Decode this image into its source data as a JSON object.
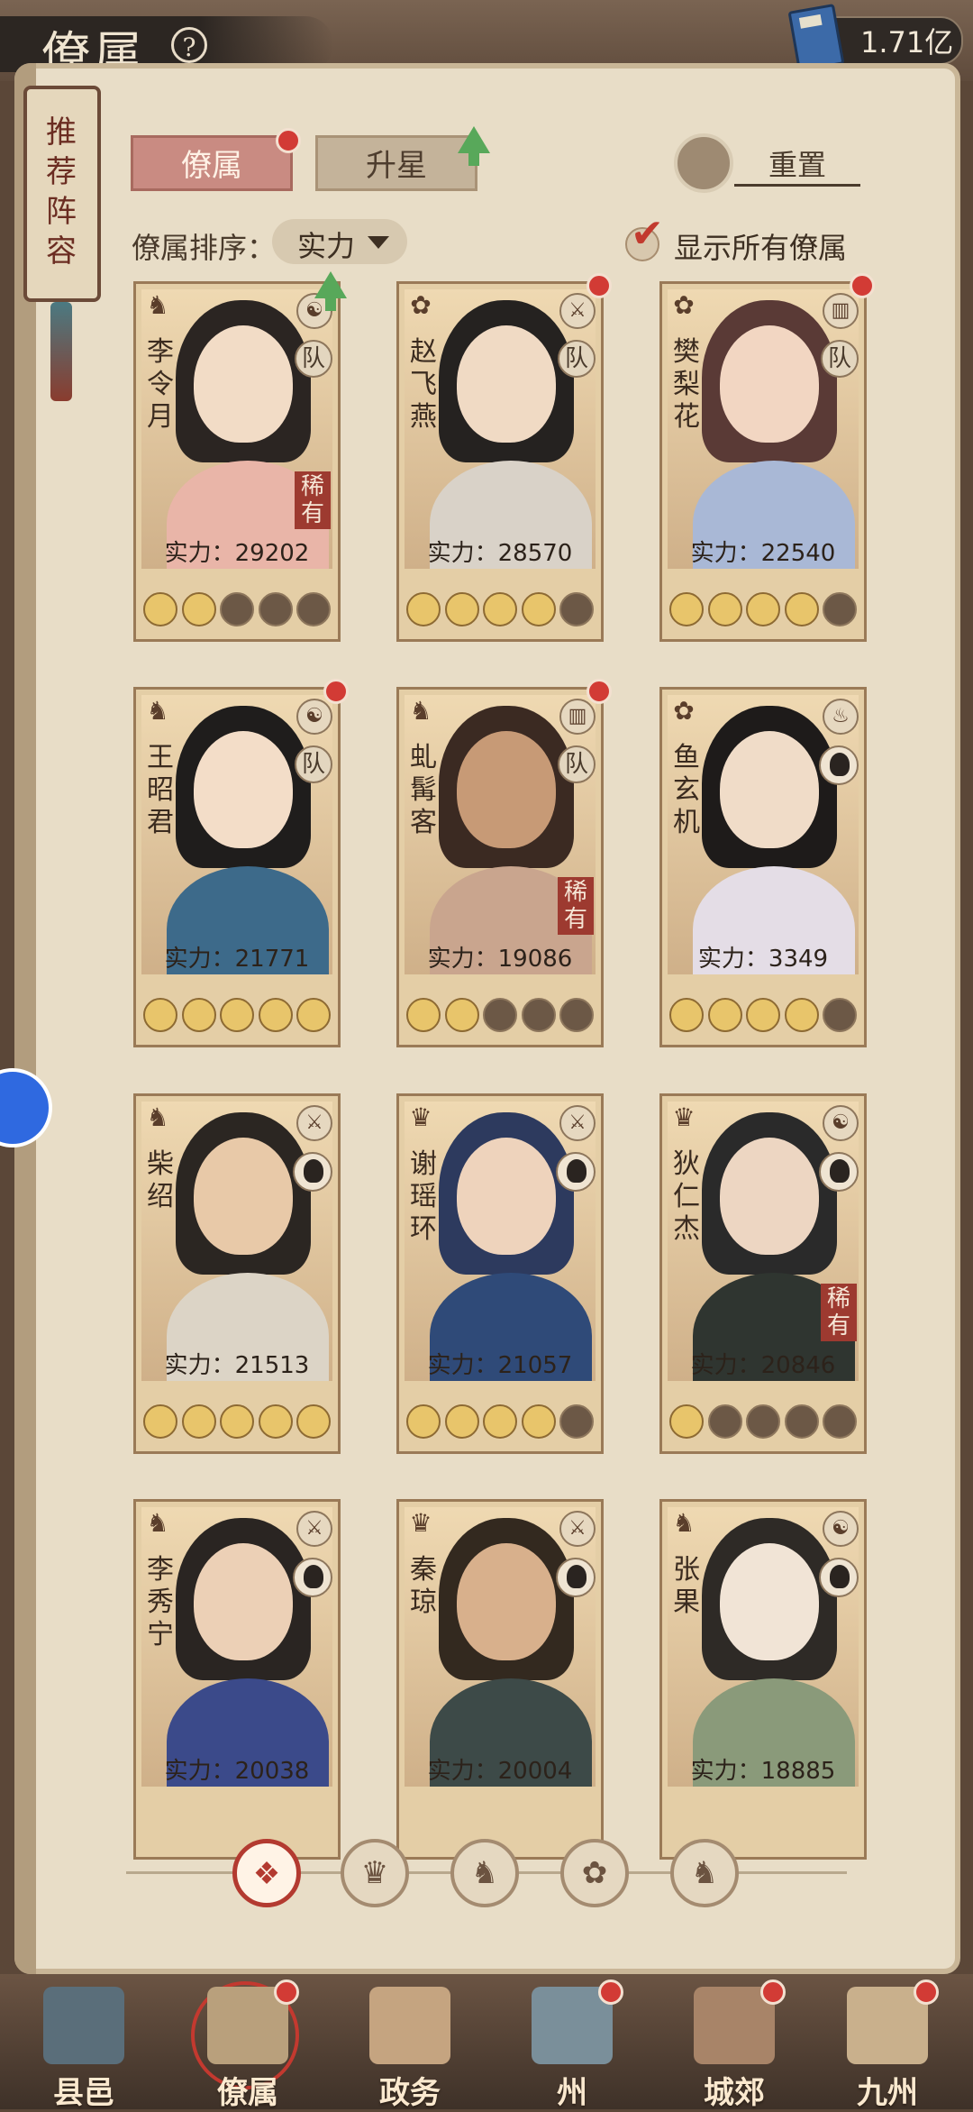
{
  "header": {
    "title": "僚属",
    "resource_value": "1.71亿"
  },
  "recommend": {
    "label": "推荐阵容"
  },
  "tabs": [
    {
      "label": "僚属"
    },
    {
      "label": "升星"
    }
  ],
  "reset": {
    "label": "重置"
  },
  "sort": {
    "label": "僚属排序：",
    "value": "实力"
  },
  "show_all": {
    "label": "显示所有僚属",
    "checked": true
  },
  "cards": [
    {
      "name": "李令月",
      "power": "实力：29202",
      "rare": "稀有",
      "team": "队",
      "stars": 2,
      "faction_icon": "mouse-icon",
      "role_icon": "yinyang-icon"
    },
    {
      "name": "赵飞燕",
      "power": "实力：28570",
      "team": "队",
      "stars": 4,
      "faction_icon": "fan-icon",
      "role_icon": "sword-icon"
    },
    {
      "name": "樊梨花",
      "power": "实力：22540",
      "team": "队",
      "stars": 4,
      "faction_icon": "fan-icon",
      "role_icon": "book-icon"
    },
    {
      "name": "王昭君",
      "power": "实力：21771",
      "team": "队",
      "stars": 5,
      "faction_icon": "mouse-icon",
      "role_icon": "yinyang-icon"
    },
    {
      "name": "虬髯客",
      "power": "实力：19086",
      "rare": "稀有",
      "team": "队",
      "stars": 2,
      "faction_icon": "mouse-icon",
      "role_icon": "book-icon"
    },
    {
      "name": "鱼玄机",
      "power": "实力：3349",
      "stars": 4,
      "faction_icon": "fan-icon",
      "role_icon": "cauldron-icon"
    },
    {
      "name": "柴绍",
      "power": "实力：21513",
      "stars": 5,
      "faction_icon": "mouse-icon",
      "role_icon": "sword-icon"
    },
    {
      "name": "谢瑶环",
      "power": "实力：21057",
      "stars": 4,
      "faction_icon": "cat-icon",
      "role_icon": "sword-icon"
    },
    {
      "name": "狄仁杰",
      "power": "实力：20846",
      "rare": "稀有",
      "stars": 1,
      "faction_icon": "cat-icon",
      "role_icon": "yinyang-icon"
    },
    {
      "name": "李秀宁",
      "power": "实力：20038",
      "faction_icon": "mouse-icon",
      "role_icon": "sword-icon"
    },
    {
      "name": "秦琼",
      "power": "实力：20004",
      "faction_icon": "cat-icon",
      "role_icon": "sword-icon"
    },
    {
      "name": "张果",
      "power": "实力：18885",
      "faction_icon": "mouse-icon",
      "role_icon": "yinyang-icon"
    }
  ],
  "filters": [
    {
      "icon": "diamond-grid-icon",
      "active": true
    },
    {
      "icon": "cat-icon"
    },
    {
      "icon": "mouse-icon"
    },
    {
      "icon": "fan-icon"
    },
    {
      "icon": "mouse-icon"
    }
  ],
  "nav": [
    {
      "label": "县邑"
    },
    {
      "label": "僚属",
      "active": true
    },
    {
      "label": "政务"
    },
    {
      "label": "州"
    },
    {
      "label": "城郊"
    },
    {
      "label": "九州"
    }
  ]
}
